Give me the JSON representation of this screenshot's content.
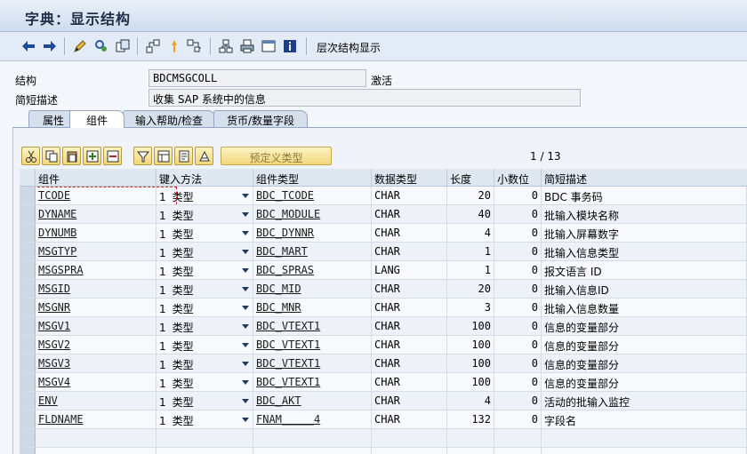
{
  "window": {
    "title": "字典：显示结构"
  },
  "toolbar": {
    "buttons": [
      {
        "name": "back-arrow-icon"
      },
      {
        "name": "forward-arrow-icon"
      },
      {
        "name": "edit-pencil-icon"
      },
      {
        "name": "display-change-icon"
      },
      {
        "name": "object-copy-icon"
      },
      {
        "name": "hierarchy-icon"
      },
      {
        "name": "activate-icon"
      },
      {
        "name": "where-used-icon"
      },
      {
        "name": "structure-tree-icon"
      },
      {
        "name": "print-icon"
      },
      {
        "name": "layout-icon"
      },
      {
        "name": "info-icon"
      }
    ],
    "hierarchy_label": "层次结构显示"
  },
  "header": {
    "structure_label": "结构",
    "structure_value": "BDCMSGCOLL",
    "status": "激活",
    "short_desc_label": "简短描述",
    "short_desc_value": "收集 SAP 系统中的信息"
  },
  "tabs": [
    {
      "label": "属性",
      "active": false
    },
    {
      "label": "组件",
      "active": true
    },
    {
      "label": "输入帮助/检查",
      "active": false
    },
    {
      "label": "货币/数量字段",
      "active": false
    }
  ],
  "components_toolbar": {
    "predefined_type_label": "预定义类型",
    "page_current": "1",
    "page_sep": "/",
    "page_total": "13"
  },
  "grid": {
    "columns": [
      "组件",
      "键入方法",
      "组件类型",
      "数据类型",
      "长度",
      "小数位",
      "简短描述"
    ],
    "rows": [
      {
        "component": "TCODE",
        "m1": "1",
        "method": "类型",
        "type": "BDC_TCODE",
        "dtype": "CHAR",
        "len": "20",
        "dec": "0",
        "desc": " BDC 事务码"
      },
      {
        "component": "DYNAME",
        "m1": "1",
        "method": "类型",
        "type": "BDC_MODULE",
        "dtype": "CHAR",
        "len": "40",
        "dec": "0",
        "desc": "批输入模块名称"
      },
      {
        "component": "DYNUMB",
        "m1": "1",
        "method": "类型",
        "type": "BDC_DYNNR",
        "dtype": "CHAR",
        "len": "4",
        "dec": "0",
        "desc": "批输入屏幕数字"
      },
      {
        "component": "MSGTYP",
        "m1": "1",
        "method": "类型",
        "type": "BDC_MART",
        "dtype": "CHAR",
        "len": "1",
        "dec": "0",
        "desc": "批输入信息类型"
      },
      {
        "component": "MSGSPRA",
        "m1": "1",
        "method": "类型",
        "type": "BDC_SPRAS",
        "dtype": "LANG",
        "len": "1",
        "dec": "0",
        "desc": "报文语言 ID"
      },
      {
        "component": "MSGID",
        "m1": "1",
        "method": "类型",
        "type": "BDC_MID",
        "dtype": "CHAR",
        "len": "20",
        "dec": "0",
        "desc": "批输入信息ID"
      },
      {
        "component": "MSGNR",
        "m1": "1",
        "method": "类型",
        "type": "BDC_MNR",
        "dtype": "CHAR",
        "len": "3",
        "dec": "0",
        "desc": "批输入信息数量"
      },
      {
        "component": "MSGV1",
        "m1": "1",
        "method": "类型",
        "type": "BDC_VTEXT1",
        "dtype": "CHAR",
        "len": "100",
        "dec": "0",
        "desc": "信息的变量部分"
      },
      {
        "component": "MSGV2",
        "m1": "1",
        "method": "类型",
        "type": "BDC_VTEXT1",
        "dtype": "CHAR",
        "len": "100",
        "dec": "0",
        "desc": "信息的变量部分"
      },
      {
        "component": "MSGV3",
        "m1": "1",
        "method": "类型",
        "type": "BDC_VTEXT1",
        "dtype": "CHAR",
        "len": "100",
        "dec": "0",
        "desc": "信息的变量部分"
      },
      {
        "component": "MSGV4",
        "m1": "1",
        "method": "类型",
        "type": "BDC_VTEXT1",
        "dtype": "CHAR",
        "len": "100",
        "dec": "0",
        "desc": "信息的变量部分"
      },
      {
        "component": "ENV",
        "m1": "1",
        "method": "类型",
        "type": "BDC_AKT",
        "dtype": "CHAR",
        "len": "4",
        "dec": "0",
        "desc": "活动的批输入监控"
      },
      {
        "component": "FLDNAME",
        "m1": "1",
        "method": "类型",
        "type": "FNAM_____4",
        "dtype": "CHAR",
        "len": "132",
        "dec": "0",
        "desc": "字段名"
      }
    ]
  }
}
